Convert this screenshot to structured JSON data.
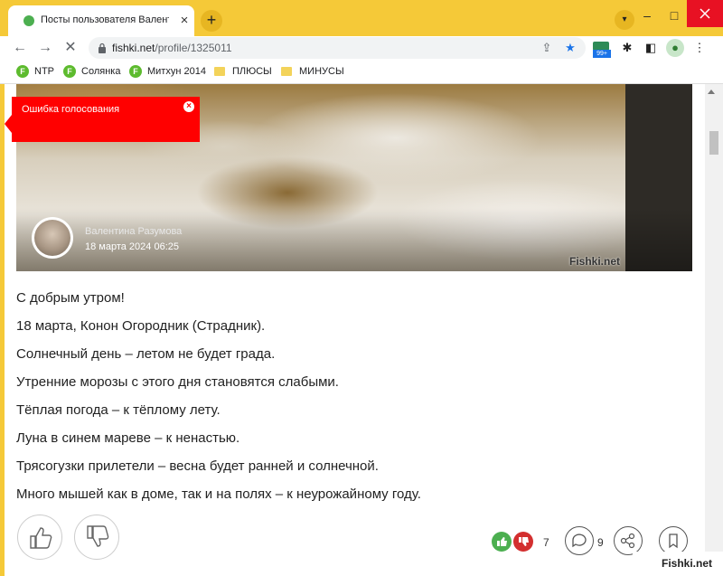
{
  "browser": {
    "tab_title": "Посты пользователя Валентина",
    "url_host": "fishki.net",
    "url_path": "/profile/1325011",
    "ext_badge": "99+"
  },
  "bookmarks": [
    {
      "label": "NTP",
      "icon": "F"
    },
    {
      "label": "Солянка",
      "icon": "F"
    },
    {
      "label": "Митхун 2014",
      "icon": "F"
    },
    {
      "label": "ПЛЮСЫ",
      "icon": "folder-icon"
    },
    {
      "label": "МИНУСЫ",
      "icon": "folder-icon"
    }
  ],
  "error_popup": {
    "text": "Ошибка голосования"
  },
  "post": {
    "author": "Валентина Разумова",
    "date": "18 марта 2024 06:25",
    "image_watermark": "Fishki.net",
    "lines": [
      "С добрым утром!",
      "18 марта, Конон Огородник (Страдник).",
      "Солнечный день – летом не будет града.",
      "Утренние морозы с этого дня становятся слабыми.",
      "Тёплая погода – к тёплому лету.",
      "Луна в синем мареве – к ненастью.",
      "Трясогузки прилетели – весна будет ранней и солнечной.",
      "Много мышей как в доме, так и на полях – к неурожайному году."
    ]
  },
  "actions": {
    "votes": "7",
    "comments": "9"
  },
  "corner_watermark": "Fishki.net",
  "colors": {
    "error": "#ff0000",
    "tabstrip": "#f5c938",
    "vote_up": "#4caf50",
    "vote_down": "#d32f2f"
  }
}
